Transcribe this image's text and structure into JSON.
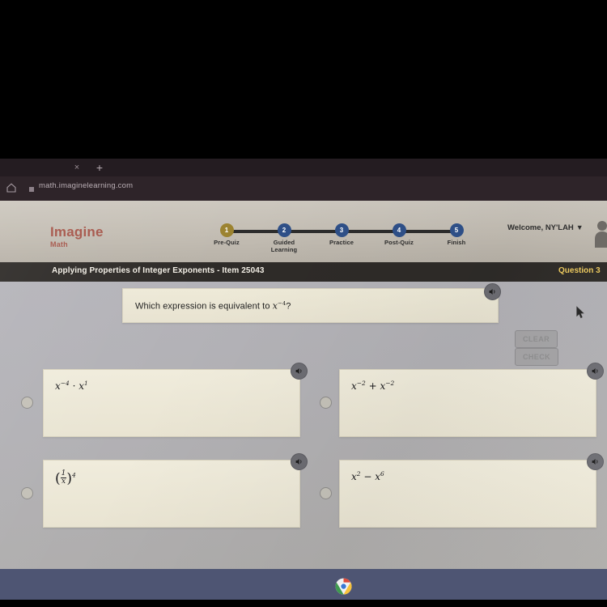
{
  "browser": {
    "tab_close_label": "×",
    "new_tab_label": "+",
    "home_icon": "home-icon",
    "lock_icon": "site-info-icon",
    "url": "math.imaginelearning.com"
  },
  "app": {
    "logo": {
      "primary": "Imagine",
      "secondary": "Math"
    },
    "stepper": {
      "steps": [
        {
          "number": "1",
          "label": "Pre-Quiz",
          "active": true
        },
        {
          "number": "2",
          "label": "Guided\nLearning",
          "active": false
        },
        {
          "number": "3",
          "label": "Practice",
          "active": false
        },
        {
          "number": "4",
          "label": "Post-Quiz",
          "active": false
        },
        {
          "number": "5",
          "label": "Finish",
          "active": false
        }
      ],
      "active_color": "#9c8330",
      "inactive_color": "#2e4f87"
    },
    "welcome": {
      "text": "Welcome, NY'LAH",
      "caret": "▼"
    },
    "titlebar": {
      "title": "Applying Properties of Integer Exponents - Item 25043",
      "question_label": "Question 3",
      "question_color": "#f1cd5f"
    },
    "question": {
      "prefix": "Which expression is equivalent to ",
      "base": "x",
      "exponent": "−4",
      "suffix": "?"
    },
    "buttons": {
      "clear": "CLEAR",
      "check": "CHECK"
    },
    "answers": [
      {
        "id": "a",
        "base1": "x",
        "exp1": "−4",
        "op": "·",
        "base2": "x",
        "exp2": "1",
        "kind": "product",
        "selected": false
      },
      {
        "id": "b",
        "base1": "x",
        "exp1": "−2",
        "op": "+",
        "base2": "x",
        "exp2": "−2",
        "kind": "sum",
        "selected": false
      },
      {
        "id": "c",
        "num": "1",
        "den": "x",
        "exp": "4",
        "kind": "fraction-power",
        "selected": false
      },
      {
        "id": "d",
        "base1": "x",
        "exp1": "2",
        "op": "−",
        "base2": "x",
        "exp2": "6",
        "kind": "difference",
        "selected": false
      }
    ],
    "speaker_icon": "speaker-icon",
    "avatar_icon": "avatar-icon"
  },
  "taskbar": {
    "chrome_icon": "chrome-icon"
  },
  "cursor": {
    "icon": "mouse-pointer-icon"
  }
}
